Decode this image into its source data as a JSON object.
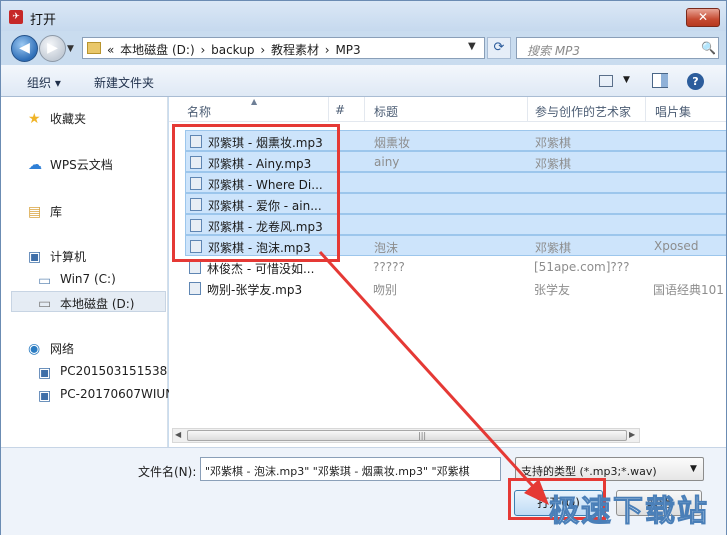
{
  "window": {
    "title": "打开",
    "app_icon_glyph": "✈",
    "close_glyph": "✕"
  },
  "nav": {
    "back_glyph": "◀",
    "fwd_glyph": "▶",
    "hist_glyph": "▼",
    "crumbs": [
      "«",
      "本地磁盘 (D:)",
      "›",
      "backup",
      "›",
      "教程素材",
      "›",
      "MP3"
    ],
    "addr_drop_glyph": "▼",
    "refresh_glyph": "⟳",
    "search_placeholder": "搜索 MP3",
    "search_glyph": "🔍"
  },
  "toolbar": {
    "organize": "组织 ▾",
    "new_folder": "新建文件夹",
    "view_drop_glyph": "▼",
    "help_glyph": "?"
  },
  "sidebar": [
    {
      "label": "收藏夹",
      "icon": "star-icon",
      "glyph": "★",
      "color": "#f0b428"
    },
    {
      "label": "WPS云文档",
      "icon": "cloud-icon",
      "glyph": "☁",
      "color": "#2f7fd6"
    },
    {
      "label": "库",
      "icon": "library-icon",
      "glyph": "▤",
      "color": "#d9a441"
    },
    {
      "label": "计算机",
      "icon": "computer-icon",
      "glyph": "▣",
      "color": "#3f6fa8"
    },
    {
      "label": "Win7 (C:)",
      "icon": "drive-c-icon",
      "glyph": "▭",
      "color": "#6a8fb8"
    },
    {
      "label": "本地磁盘 (D:)",
      "icon": "drive-d-icon",
      "glyph": "▭",
      "color": "#7d7d7d"
    },
    {
      "label": "网络",
      "icon": "network-icon",
      "glyph": "◉",
      "color": "#2b7cc2"
    },
    {
      "label": "PC201503151538",
      "icon": "pc-icon",
      "glyph": "▣",
      "color": "#3f6fa8"
    },
    {
      "label": "PC-20170607WIUN",
      "icon": "pc-icon",
      "glyph": "▣",
      "color": "#3f6fa8"
    }
  ],
  "columns": {
    "name": "名称",
    "track": "#",
    "title": "标题",
    "artist": "参与创作的艺术家",
    "album": "唱片集",
    "sort_glyph": "▲"
  },
  "files": [
    {
      "name": "邓紫琪 - 烟熏妆.mp3",
      "title": "烟熏妆",
      "artist": "邓紫棋",
      "album": "",
      "selected": true
    },
    {
      "name": "邓紫棋 - Ainy.mp3",
      "title": "ainy",
      "artist": "邓紫棋",
      "album": "",
      "selected": true
    },
    {
      "name": "邓紫棋 - Where Di...",
      "title": "",
      "artist": "",
      "album": "",
      "selected": true
    },
    {
      "name": "邓紫棋 - 爱你 - ain...",
      "title": "",
      "artist": "",
      "album": "",
      "selected": true
    },
    {
      "name": "邓紫棋 - 龙卷风.mp3",
      "title": "",
      "artist": "",
      "album": "",
      "selected": true
    },
    {
      "name": "邓紫棋 - 泡沫.mp3",
      "title": "泡沫",
      "artist": "邓紫棋",
      "album": "Xposed",
      "selected": true
    },
    {
      "name": "林俊杰 - 可惜没如...",
      "title": "?????",
      "artist": "[51ape.com]???",
      "album": "",
      "selected": false
    },
    {
      "name": "吻别-张学友.mp3",
      "title": "吻别",
      "artist": "张学友",
      "album": "国语经典101",
      "selected": false
    }
  ],
  "scrollbar": {
    "left_glyph": "◀",
    "right_glyph": "▶",
    "grip_glyph": "|||"
  },
  "bottom": {
    "filename_label": "文件名(N):",
    "filename_value": "\"邓紫棋 - 泡沫.mp3\" \"邓紫琪 - 烟熏妆.mp3\" \"邓紫棋",
    "fn_drop_glyph": "▼",
    "filetype": "支持的类型 (*.mp3;*.wav)",
    "ft_drop_glyph": "▼",
    "open": "打开(O)",
    "cancel": "取消"
  },
  "watermark": "极速下载站",
  "colors": {
    "highlight": "#e53935",
    "selection": "#cde4fb"
  }
}
